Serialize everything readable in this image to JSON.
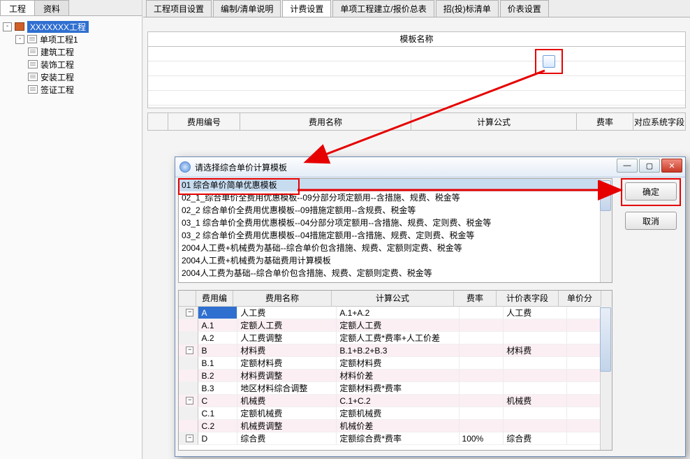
{
  "left_tabs": {
    "tab1": "工程",
    "tab2": "资料"
  },
  "tree": {
    "root": "XXXXXXX工程",
    "sub": "单项工程1",
    "leaves": [
      "建筑工程",
      "装饰工程",
      "安装工程",
      "签证工程"
    ]
  },
  "top_tabs": [
    "工程项目设置",
    "编制/清单说明",
    "计费设置",
    "单项工程建立/报价总表",
    "招(投)标清单",
    "价表设置"
  ],
  "active_top_tab": 2,
  "template_header": "模板名称",
  "fee_headers": [
    "",
    "费用编号",
    "费用名称",
    "计算公式",
    "费率",
    "对应系统字段"
  ],
  "dialog": {
    "title": "请选择综合单价计算模板",
    "ok": "确定",
    "cancel": "取消",
    "templates": [
      "01 综合单价简单优惠模板",
      "02_1_综合单价全费用优惠模板--09分部分项定额用--含措施、规费、税金等",
      "02_2 综合单价全费用优惠模板--09措施定额用--含规费、税金等",
      "03_1 综合单价全费用优惠模板--04分部分项定额用--含措施、规费、定则费、税金等",
      "03_2 综合单价全费用优惠模板--04措施定额用--含措施、规费、定则费、税金等",
      "2004人工费+机械费为基础--综合单价包含措施、规费、定额则定费、税金等",
      "2004人工费+机械费为基础费用计算模板",
      "2004人工费为基础--综合单价包含措施、规费、定额则定费、税金等"
    ],
    "selected_template": 0,
    "grid_headers": [
      "",
      "费用编",
      "费用名称",
      "计算公式",
      "费率",
      "计价表字段",
      "单价分"
    ],
    "grid_rows": [
      {
        "box": "−",
        "code": "A",
        "name": "人工费",
        "formula": "A.1+A.2",
        "rate": "",
        "field": "人工费",
        "alt": false,
        "hdr": true
      },
      {
        "box": "",
        "code": "A.1",
        "name": "定额人工费",
        "formula": "定额人工费",
        "rate": "",
        "field": "",
        "alt": true
      },
      {
        "box": "",
        "code": "A.2",
        "name": "人工费调整",
        "formula": "定额人工费*费率+人工价差",
        "rate": "",
        "field": "",
        "alt": false
      },
      {
        "box": "−",
        "code": "B",
        "name": "材料费",
        "formula": "B.1+B.2+B.3",
        "rate": "",
        "field": "材料费",
        "alt": true
      },
      {
        "box": "",
        "code": "B.1",
        "name": "定额材料费",
        "formula": "定额材料费",
        "rate": "",
        "field": "",
        "alt": false
      },
      {
        "box": "",
        "code": "B.2",
        "name": "材料费调整",
        "formula": "材料价差",
        "rate": "",
        "field": "",
        "alt": true
      },
      {
        "box": "",
        "code": "B.3",
        "name": "地区材料综合调整",
        "formula": "定额材料费*费率",
        "rate": "",
        "field": "",
        "alt": false
      },
      {
        "box": "−",
        "code": "C",
        "name": "机械费",
        "formula": "C.1+C.2",
        "rate": "",
        "field": "机械费",
        "alt": true
      },
      {
        "box": "",
        "code": "C.1",
        "name": "定额机械费",
        "formula": "定额机械费",
        "rate": "",
        "field": "",
        "alt": false
      },
      {
        "box": "",
        "code": "C.2",
        "name": "机械费调整",
        "formula": "机械价差",
        "rate": "",
        "field": "",
        "alt": true
      },
      {
        "box": "−",
        "code": "D",
        "name": "综合费",
        "formula": "定额综合费*费率",
        "rate": "100%",
        "field": "综合费",
        "alt": false
      }
    ]
  }
}
